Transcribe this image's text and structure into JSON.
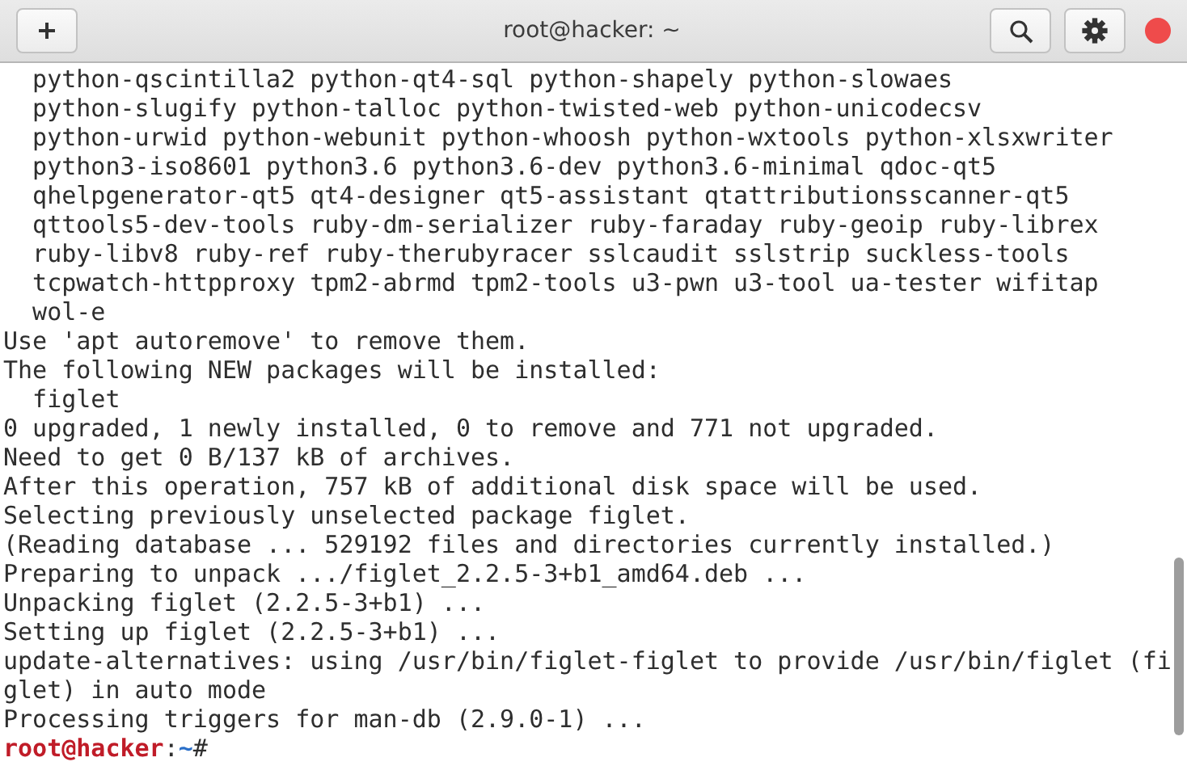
{
  "window": {
    "title": "root@hacker: ~"
  },
  "header_buttons": [
    {
      "kind": "new-tab"
    },
    {
      "kind": "search"
    },
    {
      "kind": "settings"
    },
    {
      "kind": "close"
    }
  ],
  "terminal": {
    "lines": [
      "  python-qscintilla2 python-qt4-sql python-shapely python-slowaes",
      "  python-slugify python-talloc python-twisted-web python-unicodecsv",
      "  python-urwid python-webunit python-whoosh python-wxtools python-xlsxwriter",
      "  python3-iso8601 python3.6 python3.6-dev python3.6-minimal qdoc-qt5",
      "  qhelpgenerator-qt5 qt4-designer qt5-assistant qtattributionsscanner-qt5",
      "  qttools5-dev-tools ruby-dm-serializer ruby-faraday ruby-geoip ruby-librex",
      "  ruby-libv8 ruby-ref ruby-therubyracer sslcaudit sslstrip suckless-tools",
      "  tcpwatch-httpproxy tpm2-abrmd tpm2-tools u3-pwn u3-tool ua-tester wifitap",
      "  wol-e",
      "Use 'apt autoremove' to remove them.",
      "The following NEW packages will be installed:",
      "  figlet",
      "0 upgraded, 1 newly installed, 0 to remove and 771 not upgraded.",
      "Need to get 0 B/137 kB of archives.",
      "After this operation, 757 kB of additional disk space will be used.",
      "Selecting previously unselected package figlet.",
      "(Reading database ... 529192 files and directories currently installed.)",
      "Preparing to unpack .../figlet_2.2.5-3+b1_amd64.deb ...",
      "Unpacking figlet (2.2.5-3+b1) ...",
      "Setting up figlet (2.2.5-3+b1) ...",
      "update-alternatives: using /usr/bin/figlet-figlet to provide /usr/bin/figlet (fi",
      "glet) in auto mode",
      "Processing triggers for man-db (2.9.0-1) ..."
    ],
    "prompt": {
      "user": "root@hacker",
      "separator": ":",
      "path": "~",
      "symbol": "#"
    }
  }
}
